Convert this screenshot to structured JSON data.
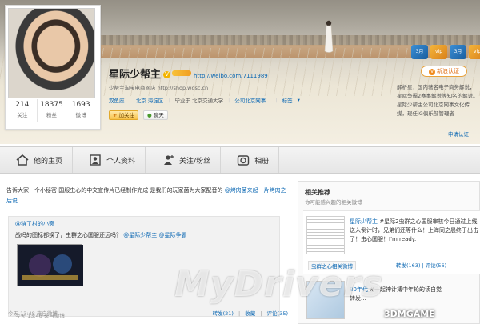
{
  "profile": {
    "name": "星际少帮主",
    "weibo_url": "http://weibo.com/7111989",
    "shop_line": "少帮主淘宝电商网店 http://shop.wosc.cn",
    "tags": [
      "双鱼座",
      "北京 海淀区",
      "毕业于 北京交通大学",
      "公司北京网事...",
      "标签"
    ],
    "follow_label": "加关注",
    "chat_label": "聊天"
  },
  "stats": [
    {
      "num": "214",
      "label": "关注"
    },
    {
      "num": "18375",
      "label": "粉丝"
    },
    {
      "num": "1693",
      "label": "微博"
    }
  ],
  "verify": {
    "button": "新浪认证",
    "text": "解析星：国内著名电子商务解说，星际争霸2赛事解说等知名的解说。星际少帮主公司北京网事文化传媒，现任iG俱乐部管理者",
    "apply": "申请认证"
  },
  "badges": [
    "3月",
    "vip",
    "3月",
    "vip"
  ],
  "tabs": [
    {
      "label": "他的主页",
      "icon": "home-icon"
    },
    {
      "label": "个人资料",
      "icon": "person-icon"
    },
    {
      "label": "关注/粉丝",
      "icon": "follow-icon"
    },
    {
      "label": "相册",
      "icon": "camera-icon"
    }
  ],
  "feed": {
    "post_text": "告诉大家一个小秘密 国服虫心的中文宣传片已经制作完成 是我们的玩家菌为大家配音的",
    "post_link": "@烤肉菌来起一片烤肉之后说",
    "repost_user": "@链了村的小斋",
    "repost_text": "战吗的图标都换了，虫群之心国服还远吗？",
    "repost_mentions": "@星际少帮主 @星际争霸",
    "repost_meta": "今天 13:46 来自微博",
    "time": "今天 13:48 来自微博",
    "actions": {
      "forward": "转发(21)",
      "collect": "收藏",
      "comment": "评论(35)"
    }
  },
  "sidebar": {
    "title": "相关推荐",
    "subtitle": "你可能感兴趣的相关微博",
    "rec1_user": "星际少帮主",
    "rec1_text": "#星际2虫群之心国服审核今日通过上线送入倒计时，兄弟们还等什么！上海同之晨终于出击了！虫心国服！I'm ready.",
    "rec1_group": "虫群之心相关微博",
    "rec1_stats": "转发(163) | 评论(56)",
    "rec2_user": "80年代",
    "rec2_text": "#一起神计搏中年轮的读自觉",
    "rec2_more": "转发..."
  },
  "watermark": "MyDrivers",
  "site_logo": "3DMGAME"
}
